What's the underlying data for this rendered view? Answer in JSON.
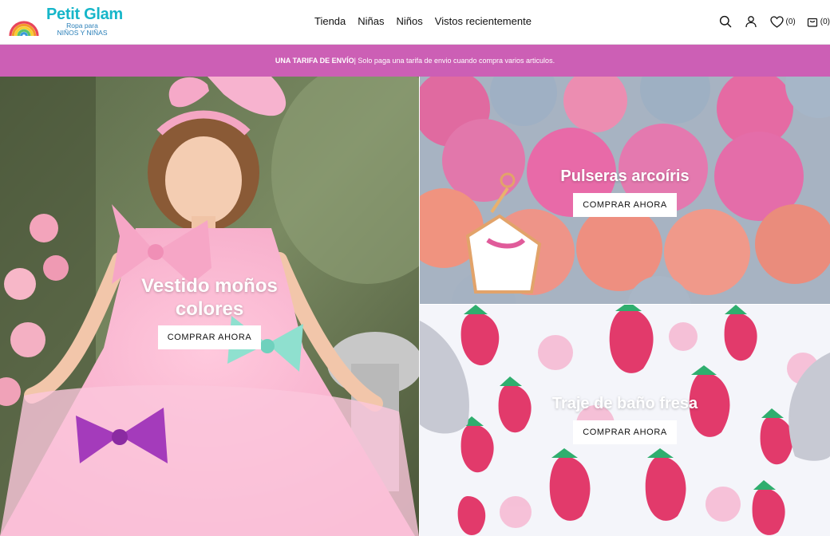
{
  "brand": {
    "name": "Petit Glam",
    "tagline_line1": "Ropa para",
    "tagline_line2": "NIÑOS Y NIÑAS",
    "colors": {
      "brand": "#16b6c9",
      "tagline": "#2a7fb8",
      "banner": "#cc5fb5"
    }
  },
  "nav": [
    {
      "label": "Tienda"
    },
    {
      "label": "Niñas"
    },
    {
      "label": "Niños"
    },
    {
      "label": "Vistos recientemente"
    }
  ],
  "header_icons": {
    "search": "search-icon",
    "account": "user-icon",
    "wishlist_count": "(0)",
    "cart_count": "(0)"
  },
  "banner": {
    "bold": "UNA TARIFA DE ENVÍO",
    "text": " | Solo paga una tarifa de envio cuando compra varios articulos."
  },
  "tiles": [
    {
      "title": "Vestido moños colores",
      "cta": "COMPRAR AHORA"
    },
    {
      "title": "Pulseras arcoíris",
      "cta": "COMPRAR AHORA"
    },
    {
      "title": "Traje de baño fresa",
      "cta": "COMPRAR AHORA"
    }
  ]
}
